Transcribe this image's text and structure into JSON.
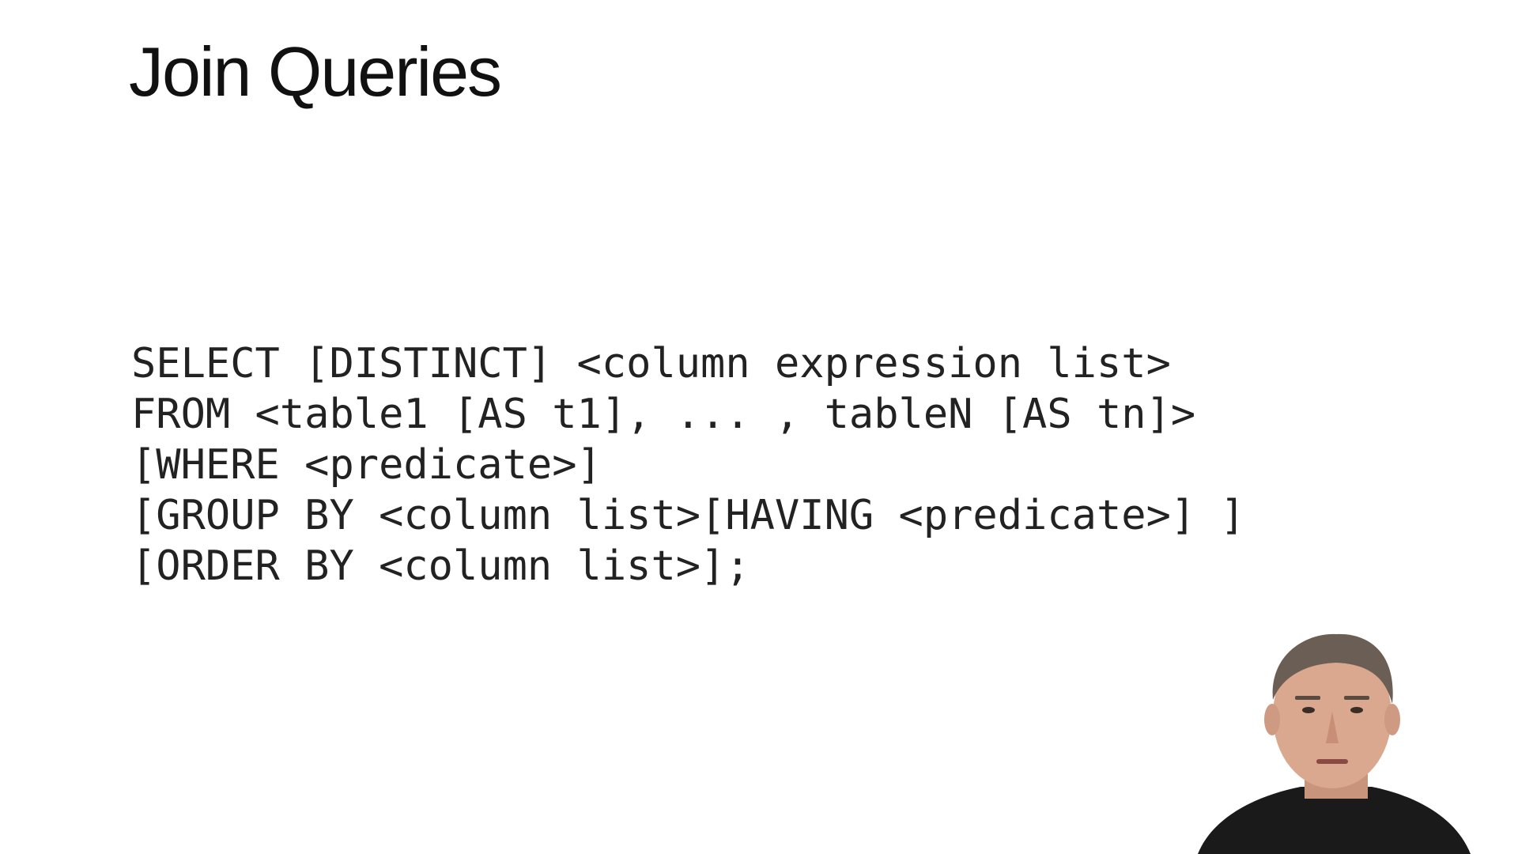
{
  "slide": {
    "title": "Join Queries",
    "code_lines": [
      "SELECT [DISTINCT] <column expression list>",
      "FROM <table1 [AS t1], ... , tableN [AS tn]>",
      "[WHERE <predicate>]",
      "[GROUP BY <column list>[HAVING <predicate>] ]",
      "[ORDER BY <column list>];"
    ]
  },
  "webcam": {
    "icon": "presenter-video",
    "colors": {
      "skin": "#d9a88f",
      "hair": "#6b5f55",
      "shirt": "#1a1a1a"
    }
  }
}
